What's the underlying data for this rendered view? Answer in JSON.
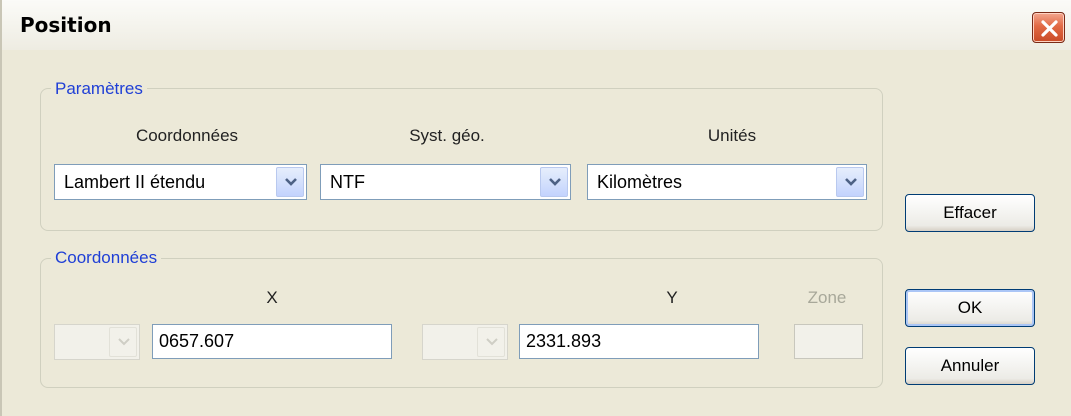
{
  "window": {
    "title": "Position",
    "close_icon": "close-icon"
  },
  "parameters": {
    "group_title": "Paramètres",
    "coordinates_label": "Coordonnées",
    "geo_system_label": "Syst. géo.",
    "units_label": "Unités",
    "coordinates_value": "Lambert II étendu",
    "geo_system_value": "NTF",
    "units_value": "Kilomètres"
  },
  "coordinates": {
    "group_title": "Coordonnées",
    "x_label": "X",
    "y_label": "Y",
    "zone_label": "Zone",
    "x_value": "0657.607",
    "y_value": "2331.893",
    "zone_value": ""
  },
  "buttons": {
    "clear_label": "Effacer",
    "ok_label": "OK",
    "cancel_label": "Annuler"
  },
  "colors": {
    "group_title": "#1f3fd6",
    "window_bg": "#ece9d8",
    "close_button": "#e26a45"
  }
}
